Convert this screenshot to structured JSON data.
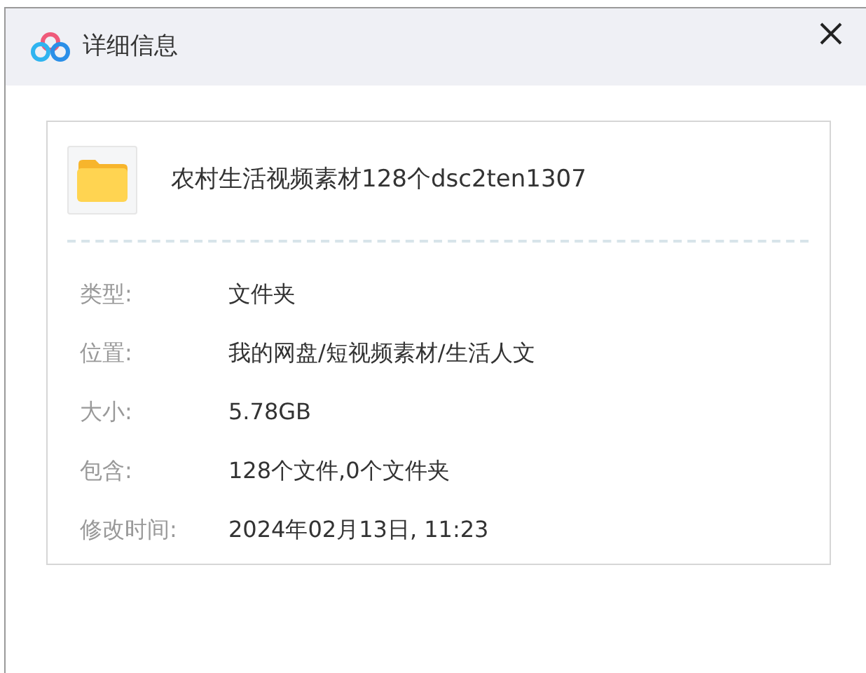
{
  "window": {
    "title": "详细信息"
  },
  "file": {
    "name": "农村生活视频素材128个dsc2ten1307"
  },
  "details": [
    {
      "label": "类型:",
      "value": "文件夹"
    },
    {
      "label": "位置:",
      "value": "我的网盘/短视频素材/生活人文"
    },
    {
      "label": "大小:",
      "value": "5.78GB"
    },
    {
      "label": "包含:",
      "value": "128个文件,0个文件夹"
    },
    {
      "label": "修改时间:",
      "value": "2024年02月13日, 11:23"
    }
  ]
}
